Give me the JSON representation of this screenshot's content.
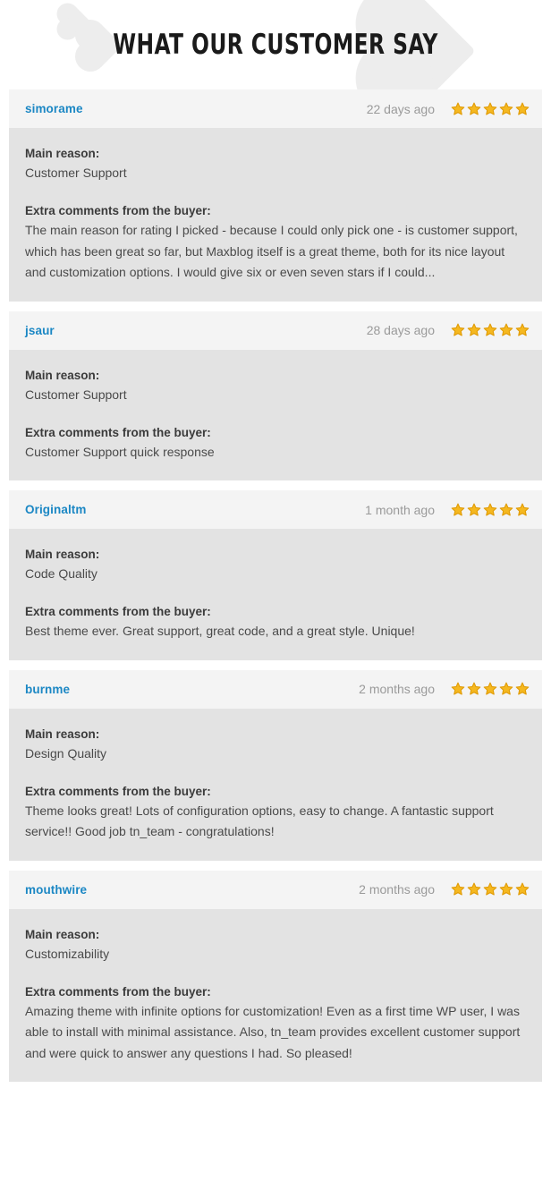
{
  "header": {
    "title": "WHAT OUR CUSTOMER SAY",
    "decorations": [
      {
        "name": "heart-large",
        "color": "#ededed"
      },
      {
        "name": "heart-medium",
        "color": "#ededed"
      },
      {
        "name": "heart-small",
        "color": "#ededed"
      }
    ]
  },
  "labels": {
    "main_reason": "Main reason:",
    "extra_comments": "Extra comments from the buyer:"
  },
  "colors": {
    "author_link": "#1b87c4",
    "star_fill": "#f5b820",
    "star_stroke": "#e09b05",
    "card_header_bg": "#f4f4f4",
    "card_body_bg": "#e3e3e3",
    "page_bg": "#ffffff",
    "date_text": "#9a9a9a",
    "body_text": "#4a4a4a",
    "heading_text": "#1a1a1a",
    "heart_fill": "#ededed"
  },
  "reviews": [
    {
      "author": "simorame",
      "date": "22 days ago",
      "rating": 5,
      "rating_icon": "star-icon",
      "main_reason": "Customer Support",
      "comment": "The main reason for rating I picked - because I could only pick one - is customer support, which has been great so far, but Maxblog itself is a great theme, both for its nice layout and customization options. I would give six or even seven stars if I could..."
    },
    {
      "author": "jsaur",
      "date": "28 days ago",
      "rating": 5,
      "rating_icon": "star-icon",
      "main_reason": "Customer Support",
      "comment": "Customer Support quick response"
    },
    {
      "author": "Originaltm",
      "date": "1 month ago",
      "rating": 5,
      "rating_icon": "star-icon",
      "main_reason": "Code Quality",
      "comment": "Best theme ever. Great support, great code, and a great style. Unique!"
    },
    {
      "author": "burnme",
      "date": "2 months ago",
      "rating": 5,
      "rating_icon": "star-icon",
      "main_reason": "Design Quality",
      "comment": "Theme looks great! Lots of configuration options, easy to change. A fantastic support service!! Good job tn_team - congratulations!"
    },
    {
      "author": "mouthwire",
      "date": "2 months ago",
      "rating": 5,
      "rating_icon": "star-icon",
      "main_reason": "Customizability",
      "comment": "Amazing theme with infinite options for customization! Even as a first time WP user, I was able to install with minimal assistance. Also, tn_team provides excellent customer support and were quick to answer any questions I had. So pleased!"
    }
  ]
}
